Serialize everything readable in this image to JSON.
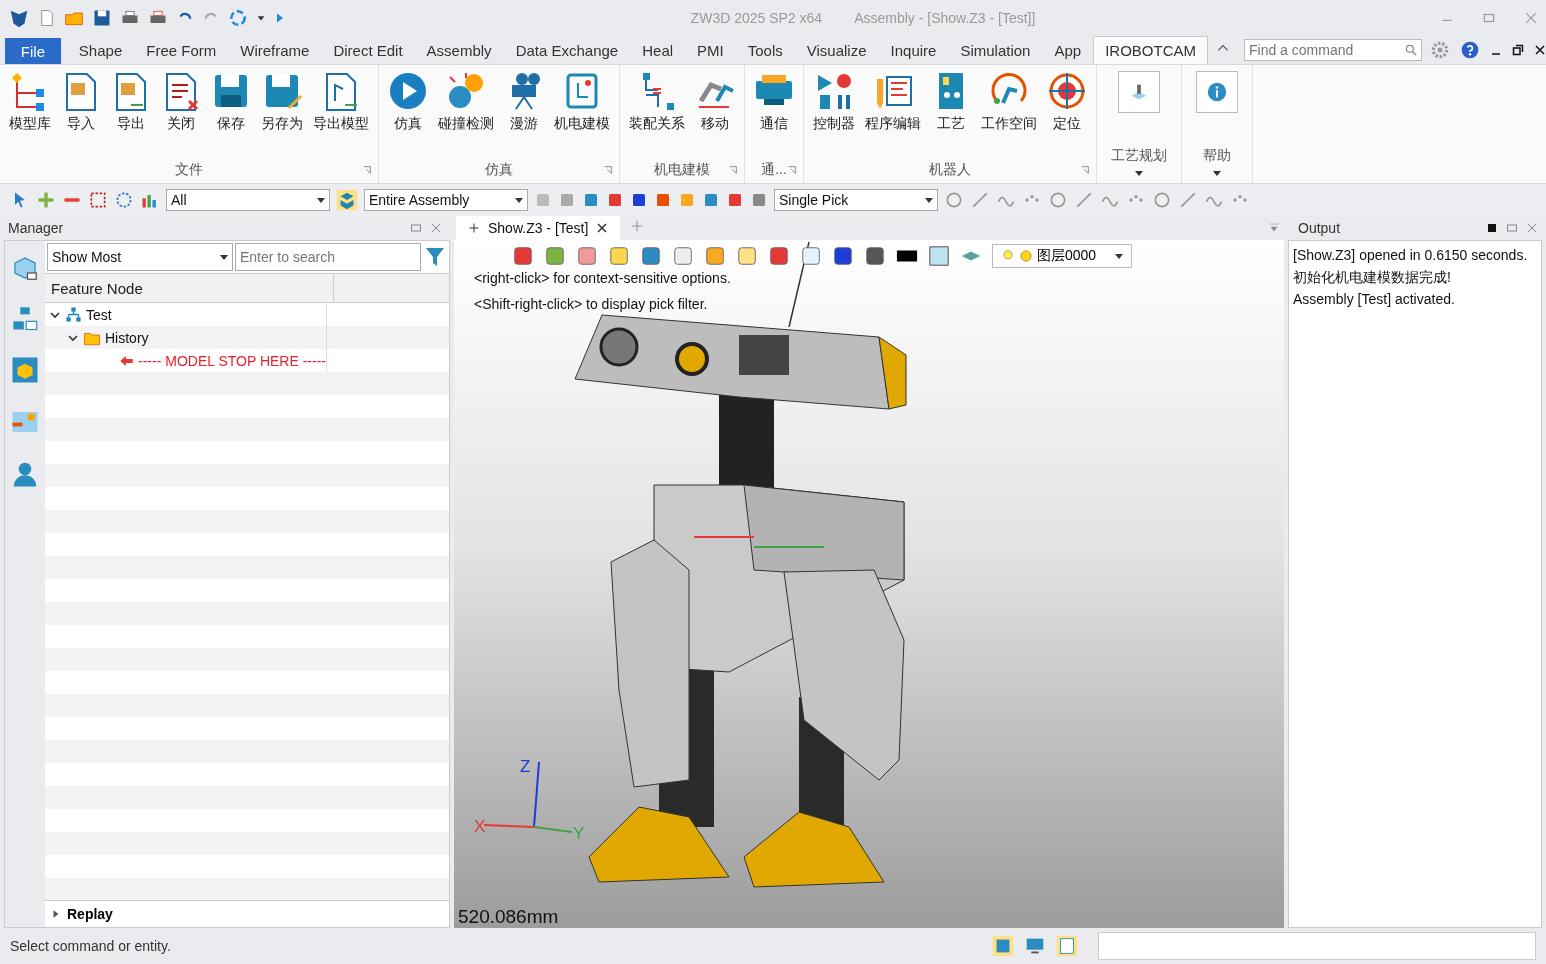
{
  "title_bar": {
    "app": "ZW3D 2025 SP2 x64",
    "document": "Assembly - [Show.Z3 - [Test]]"
  },
  "menu": {
    "file": "File",
    "search": {
      "placeholder": "Find a command"
    },
    "tabs": [
      {
        "label": "Shape",
        "selected": false
      },
      {
        "label": "Free Form",
        "selected": false
      },
      {
        "label": "Wireframe",
        "selected": false
      },
      {
        "label": "Direct Edit",
        "selected": false
      },
      {
        "label": "Assembly",
        "selected": false
      },
      {
        "label": "Data Exchange",
        "selected": false
      },
      {
        "label": "Heal",
        "selected": false
      },
      {
        "label": "PMI",
        "selected": false
      },
      {
        "label": "Tools",
        "selected": false
      },
      {
        "label": "Visualize",
        "selected": false
      },
      {
        "label": "Inquire",
        "selected": false
      },
      {
        "label": "Simulation",
        "selected": false
      },
      {
        "label": "App",
        "selected": false
      },
      {
        "label": "IROBOTCAM",
        "selected": true
      }
    ]
  },
  "ribbon": {
    "groups": [
      {
        "title": "文件",
        "items": [
          "模型库",
          "导入",
          "导出",
          "关闭",
          "保存",
          "另存为",
          "导出模型"
        ]
      },
      {
        "title": "仿真",
        "items": [
          "仿真",
          "碰撞检测",
          "漫游",
          "机电建模"
        ]
      },
      {
        "title": "机电建模",
        "items": [
          "装配关系",
          "移动"
        ]
      },
      {
        "title": "通...",
        "items": [
          "通信"
        ]
      },
      {
        "title": "机器人",
        "items": [
          "控制器",
          "程序编辑",
          "工艺",
          "工作空间",
          "定位"
        ]
      }
    ],
    "menus": [
      "工艺规划",
      "帮助"
    ]
  },
  "toolbar": {
    "filter": "All",
    "scope": "Entire Assembly",
    "pick": "Single Pick"
  },
  "manager": {
    "title": "Manager",
    "show": "Show Most",
    "search_placeholder": "Enter to search",
    "column": "Feature Node",
    "replay": "Replay",
    "tree": [
      {
        "label": "Test",
        "kind": "assembly",
        "expanded": true,
        "children": [
          {
            "label": "History",
            "kind": "folder",
            "expanded": true,
            "children": [
              {
                "label": "----- MODEL STOP HERE -----",
                "kind": "marker"
              }
            ]
          }
        ]
      }
    ]
  },
  "document_tab": {
    "label": "Show.Z3 - [Test]"
  },
  "viewport": {
    "hints": [
      "<right-click> for context-sensitive options.",
      "<Shift-right-click> to display pick filter."
    ],
    "layer": "图层0000",
    "scale": "520.086mm",
    "axes": {
      "x": "X",
      "y": "Y",
      "z": "Z"
    }
  },
  "output": {
    "title": "Output",
    "lines": [
      "[Show.Z3] opened in 0.6150 seconds.",
      "初始化机电建模数据完成!",
      "Assembly [Test] activated."
    ]
  },
  "status_bar": {
    "message": "Select command or entity."
  }
}
